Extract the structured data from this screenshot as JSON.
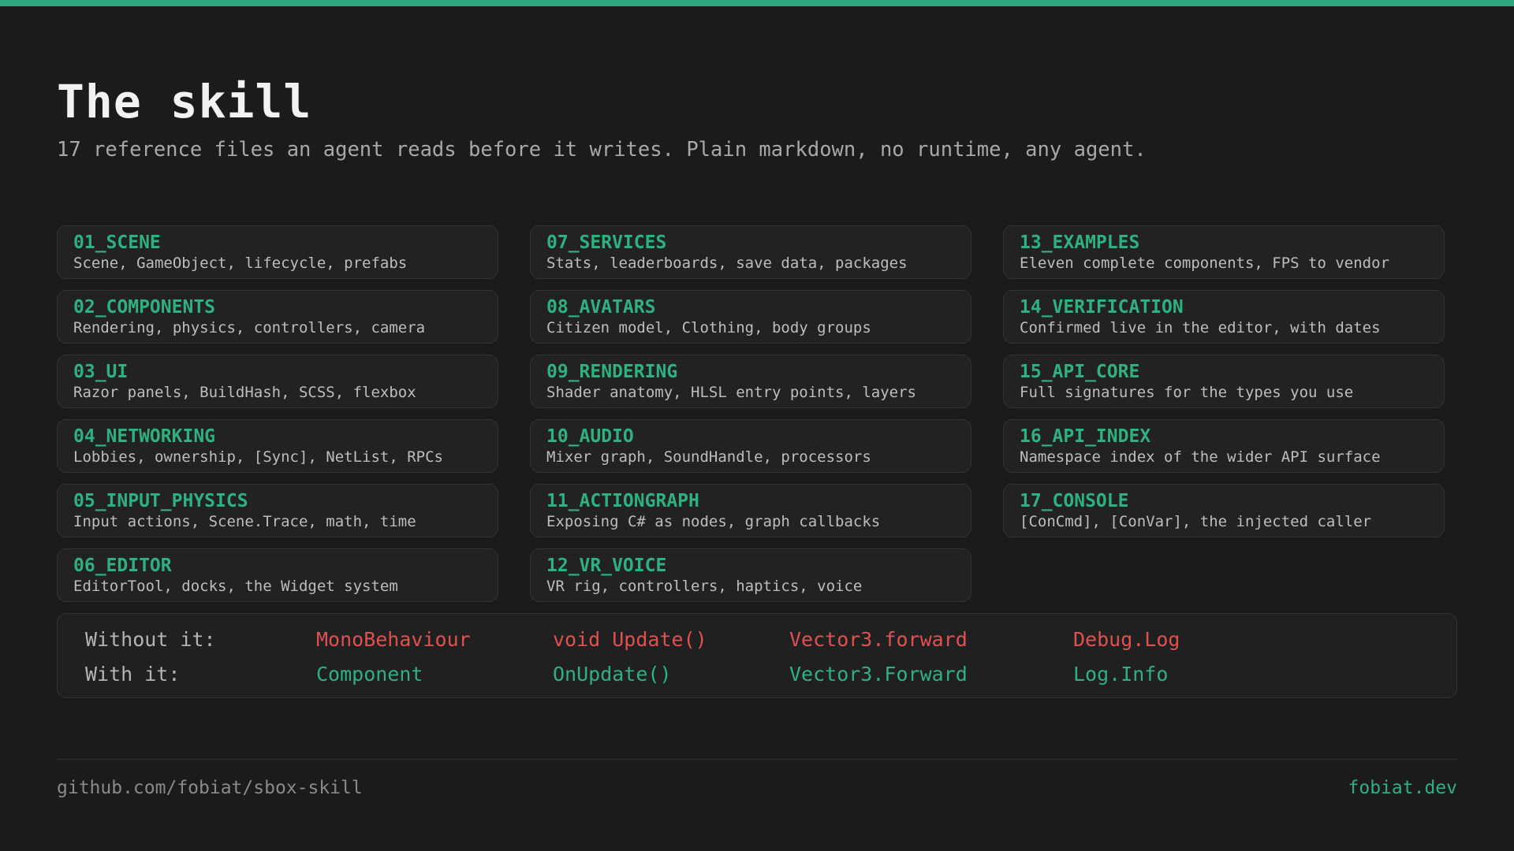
{
  "header": {
    "title": "The skill",
    "subtitle": "17 reference files an agent reads before it writes. Plain markdown, no runtime, any agent."
  },
  "files": [
    {
      "name": "01_SCENE",
      "desc": "Scene, GameObject, lifecycle, prefabs"
    },
    {
      "name": "07_SERVICES",
      "desc": "Stats, leaderboards, save data, packages"
    },
    {
      "name": "13_EXAMPLES",
      "desc": "Eleven complete components, FPS to vendor"
    },
    {
      "name": "02_COMPONENTS",
      "desc": "Rendering, physics, controllers, camera"
    },
    {
      "name": "08_AVATARS",
      "desc": "Citizen model, Clothing, body groups"
    },
    {
      "name": "14_VERIFICATION",
      "desc": "Confirmed live in the editor, with dates"
    },
    {
      "name": "03_UI",
      "desc": "Razor panels, BuildHash, SCSS, flexbox"
    },
    {
      "name": "09_RENDERING",
      "desc": "Shader anatomy, HLSL entry points, layers"
    },
    {
      "name": "15_API_CORE",
      "desc": "Full signatures for the types you use"
    },
    {
      "name": "04_NETWORKING",
      "desc": "Lobbies, ownership, [Sync], NetList, RPCs"
    },
    {
      "name": "10_AUDIO",
      "desc": "Mixer graph, SoundHandle, processors"
    },
    {
      "name": "16_API_INDEX",
      "desc": "Namespace index of the wider API surface"
    },
    {
      "name": "05_INPUT_PHYSICS",
      "desc": "Input actions, Scene.Trace, math, time"
    },
    {
      "name": "11_ACTIONGRAPH",
      "desc": "Exposing C# as nodes, graph callbacks"
    },
    {
      "name": "17_CONSOLE",
      "desc": "[ConCmd], [ConVar], the injected caller"
    },
    {
      "name": "06_EDITOR",
      "desc": "EditorTool, docks, the Widget system"
    },
    {
      "name": "12_VR_VOICE",
      "desc": "VR rig, controllers, haptics, voice"
    }
  ],
  "comparison": {
    "without_label": "Without it:",
    "with_label": "With it:",
    "without": [
      "MonoBehaviour",
      "void Update()",
      "Vector3.forward",
      "Debug.Log"
    ],
    "with": [
      "Component",
      "OnUpdate()",
      "Vector3.Forward",
      "Log.Info"
    ]
  },
  "footer": {
    "repo": "github.com/fobiat/sbox-skill",
    "site": "fobiat.dev"
  },
  "colors": {
    "accent": "#2ea87e",
    "bad": "#e0504f",
    "background": "#1b1b1b"
  }
}
